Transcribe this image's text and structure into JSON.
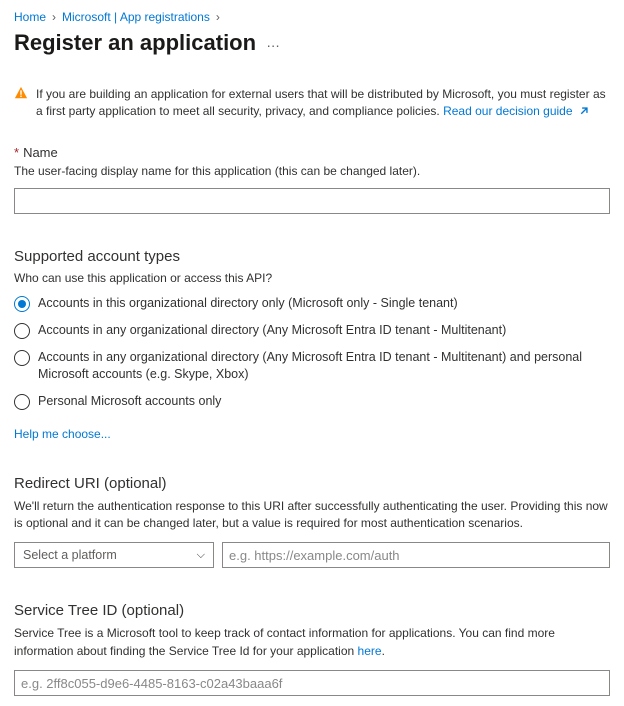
{
  "breadcrumb": {
    "home": "Home",
    "mid": "Microsoft | App registrations"
  },
  "title": "Register an application",
  "alert": {
    "text_before_link": "If you are building an application for external users that will be distributed by Microsoft, you must register as a first party application to meet all security, privacy, and compliance policies. ",
    "link": "Read our decision guide"
  },
  "name": {
    "label": "Name",
    "help": "The user-facing display name for this application (this can be changed later).",
    "value": ""
  },
  "accounts": {
    "heading": "Supported account types",
    "question": "Who can use this application or access this API?",
    "options": [
      "Accounts in this organizational directory only (Microsoft only - Single tenant)",
      "Accounts in any organizational directory (Any Microsoft Entra ID tenant - Multitenant)",
      "Accounts in any organizational directory (Any Microsoft Entra ID tenant - Multitenant) and personal Microsoft accounts (e.g. Skype, Xbox)",
      "Personal Microsoft accounts only"
    ],
    "selected_index": 0,
    "help_link": "Help me choose..."
  },
  "redirect": {
    "heading": "Redirect URI (optional)",
    "desc": "We'll return the authentication response to this URI after successfully authenticating the user. Providing this now is optional and it can be changed later, but a value is required for most authentication scenarios.",
    "platform_placeholder": "Select a platform",
    "uri_placeholder": "e.g. https://example.com/auth"
  },
  "service_tree": {
    "heading": "Service Tree ID (optional)",
    "desc_before_link": "Service Tree is a Microsoft tool to keep track of contact information for applications. You can find more information about finding the Service Tree Id for your application ",
    "link": "here",
    "desc_after_link": ".",
    "placeholder": "e.g. 2ff8c055-d9e6-4485-8163-c02a43baaa6f"
  }
}
